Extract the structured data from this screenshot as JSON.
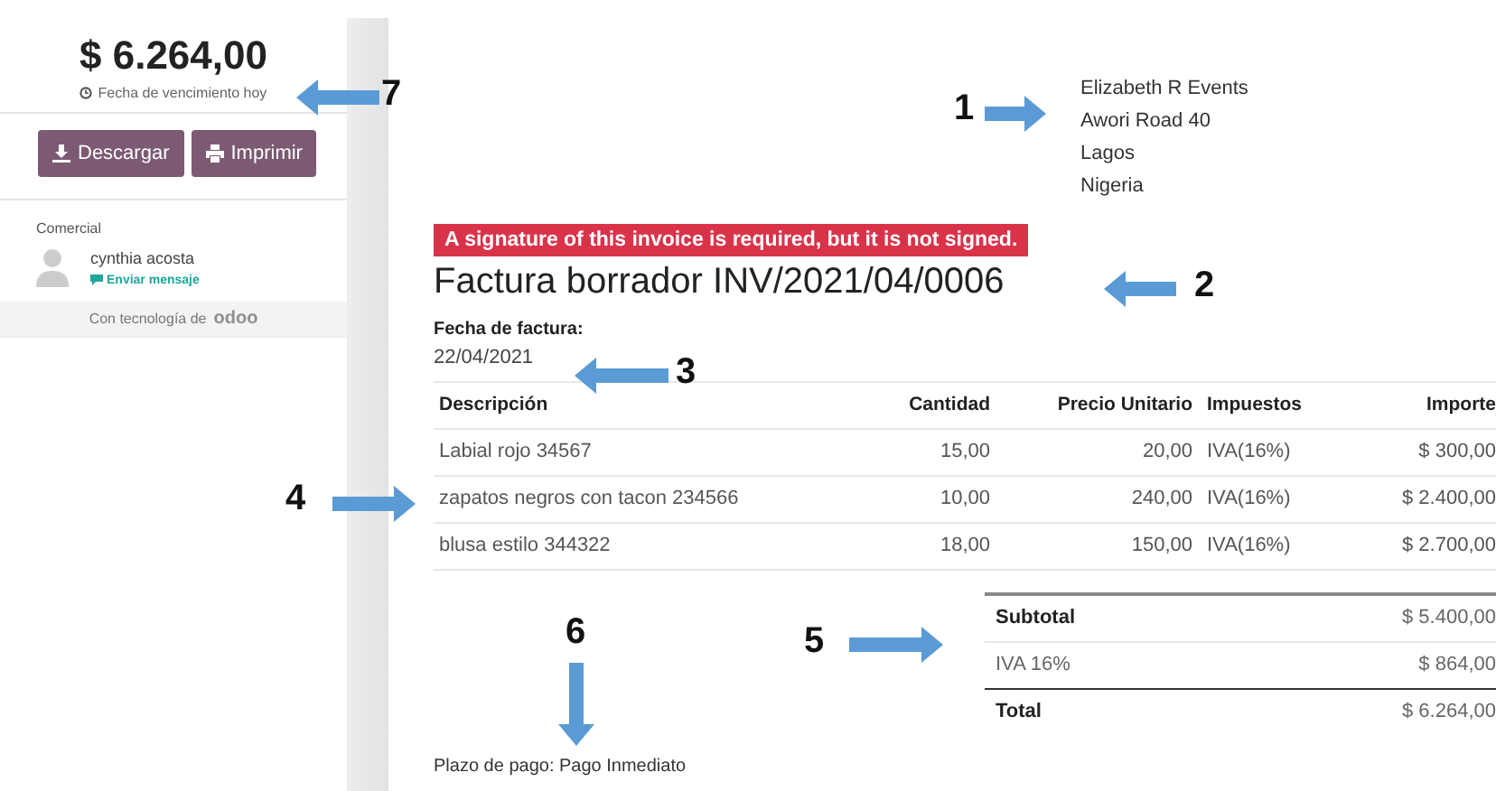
{
  "sidebar": {
    "amount": "$ 6.264,00",
    "due": "Fecha de vencimiento hoy",
    "buttons": [
      {
        "label": "Descargar",
        "kind": "download"
      },
      {
        "label": "Imprimir",
        "kind": "print"
      }
    ],
    "salesperson_label": "Comercial",
    "salesperson": "cynthia acosta",
    "message_link": "Enviar mensaje",
    "powered_by": "Con tecnología de",
    "powered_logo": "odoo"
  },
  "invoice": {
    "address": [
      "Elizabeth R Events",
      "Awori Road 40",
      "Lagos",
      "Nigeria"
    ],
    "alert": "A signature of this invoice is required, but it is not signed.",
    "title": "Factura borrador INV/2021/04/0006",
    "date_label": "Fecha de factura:",
    "date": "22/04/2021",
    "table": {
      "columns": [
        "Descripción",
        "Cantidad",
        "Precio Unitario",
        "Impuestos",
        "Importe"
      ],
      "rows": [
        [
          "Labial rojo 34567",
          "15,00",
          "20,00",
          "IVA(16%)",
          "$ 300,00"
        ],
        [
          "zapatos negros con tacon 234566",
          "10,00",
          "240,00",
          "IVA(16%)",
          "$ 2.400,00"
        ],
        [
          "blusa estilo 344322",
          "18,00",
          "150,00",
          "IVA(16%)",
          "$ 2.700,00"
        ]
      ]
    },
    "totals": [
      {
        "label": "Subtotal",
        "value": "$ 5.400,00",
        "kind": "subtotal"
      },
      {
        "label": "IVA 16%",
        "value": "$ 864,00",
        "kind": "tax"
      },
      {
        "label": "Total",
        "value": "$ 6.264,00",
        "kind": "total"
      }
    ],
    "payment_terms": "Plazo de pago: Pago Inmediato"
  },
  "annotations": [
    {
      "label": "7",
      "kind": "left"
    },
    {
      "label": "1",
      "kind": "right"
    },
    {
      "label": "2",
      "kind": "left"
    },
    {
      "label": "3",
      "kind": "left"
    },
    {
      "label": "4",
      "kind": "right"
    },
    {
      "label": "5",
      "kind": "right"
    },
    {
      "label": "6",
      "kind": "down"
    }
  ]
}
